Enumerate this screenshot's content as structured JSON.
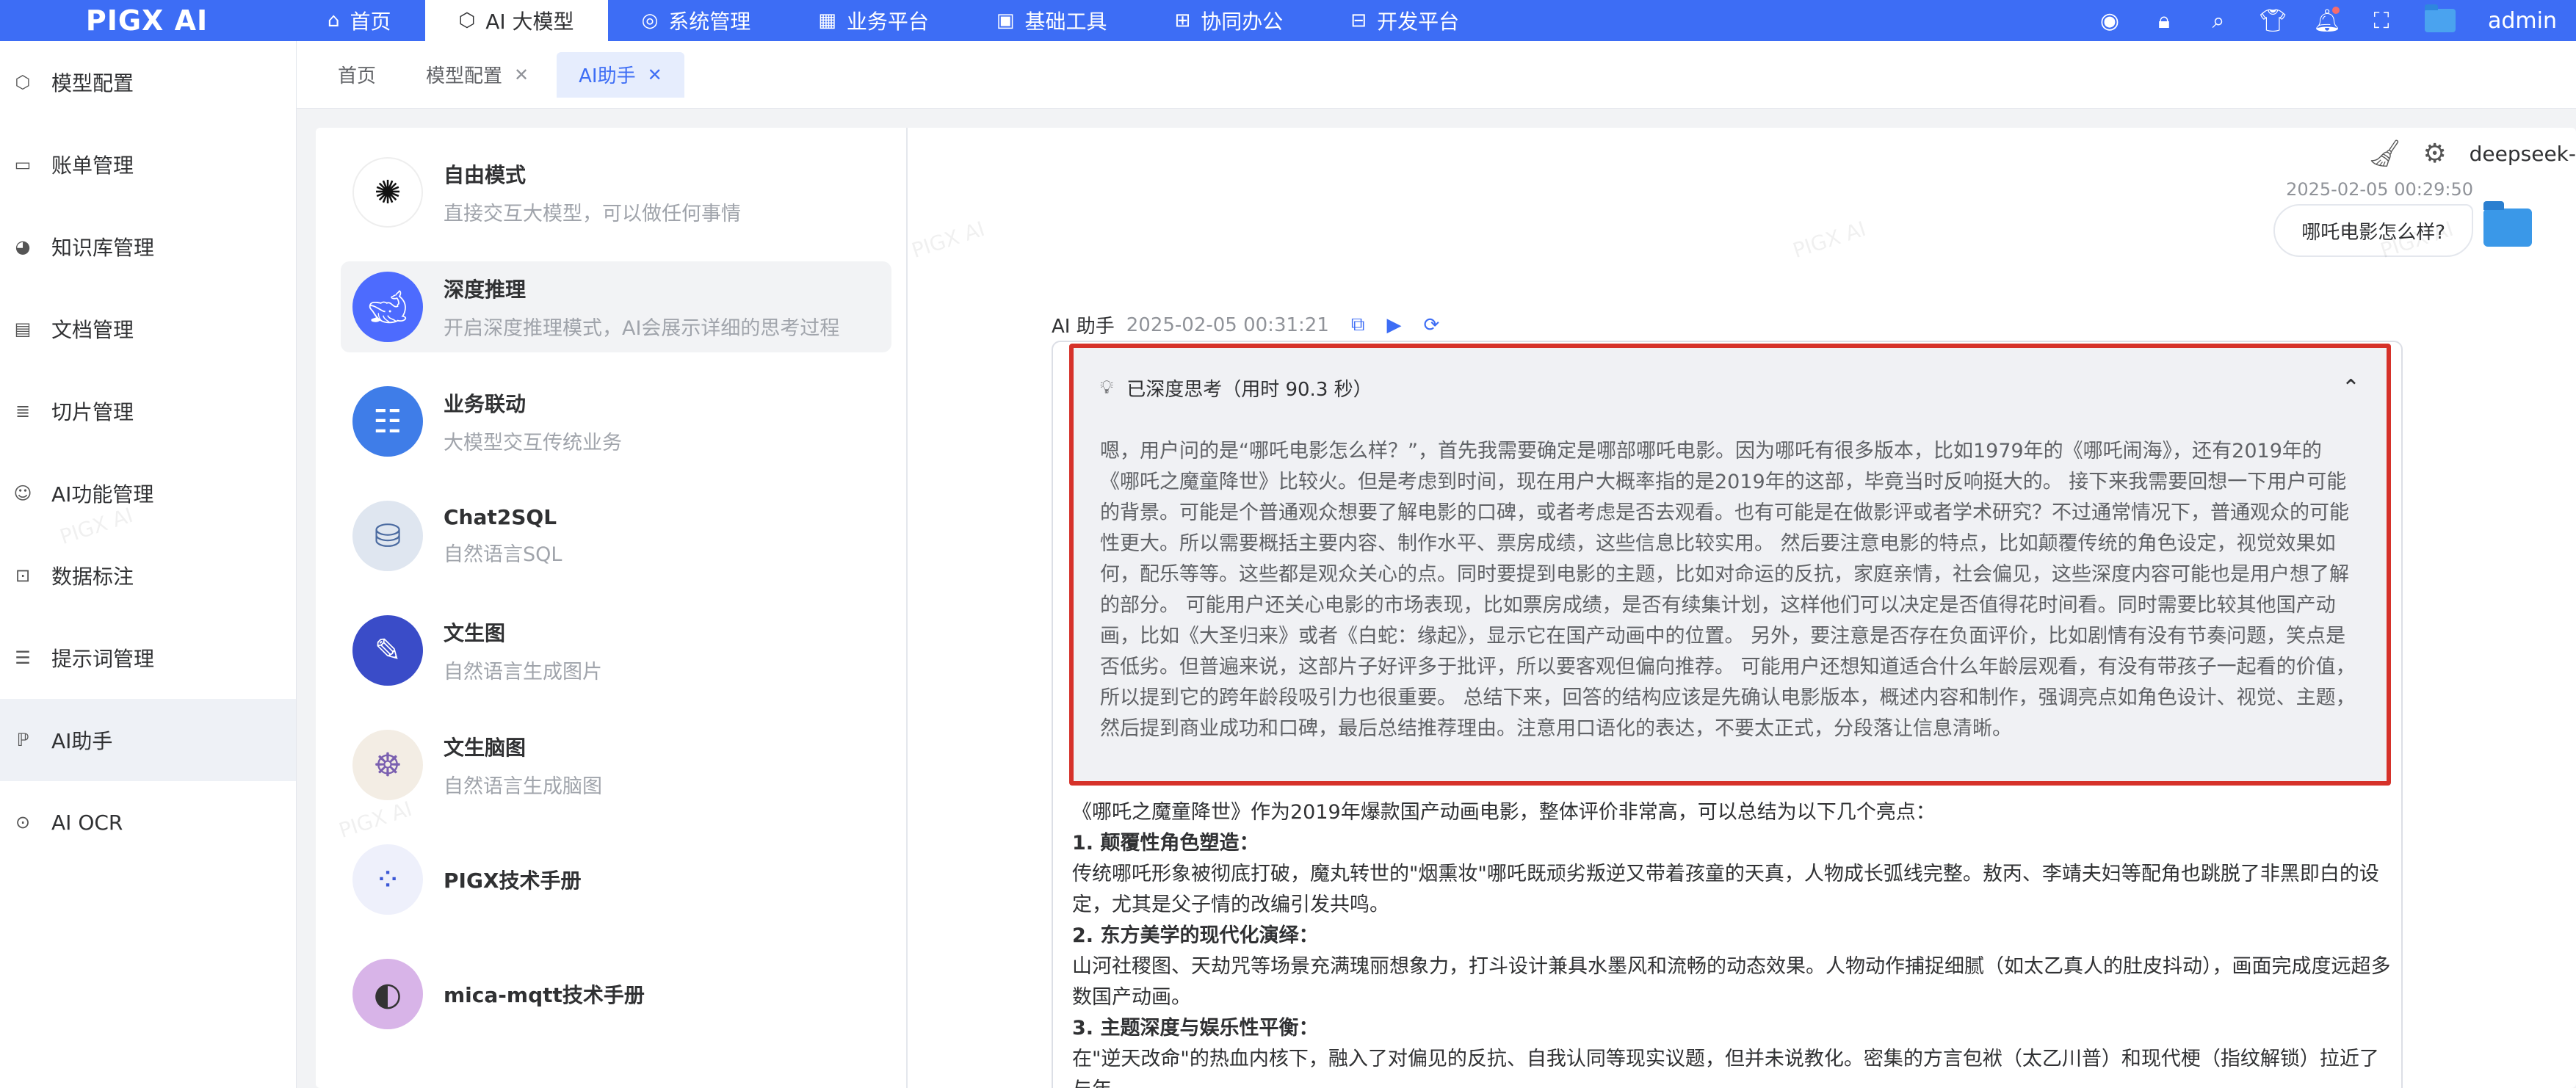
{
  "app": {
    "logo": "PIGX AI",
    "user": "admin"
  },
  "nav": [
    {
      "label": "首页",
      "icon": "home-icon"
    },
    {
      "label": "AI 大模型",
      "icon": "cube-icon",
      "active": true
    },
    {
      "label": "系统管理",
      "icon": "settings-icon"
    },
    {
      "label": "业务平台",
      "icon": "grid-icon"
    },
    {
      "label": "基础工具",
      "icon": "toolbox-icon"
    },
    {
      "label": "协同办公",
      "icon": "office-icon"
    },
    {
      "label": "开发平台",
      "icon": "dev-icon"
    }
  ],
  "sidebar": [
    {
      "label": "模型配置",
      "icon": "model-config-icon"
    },
    {
      "label": "账单管理",
      "icon": "bill-icon"
    },
    {
      "label": "知识库管理",
      "icon": "knowledge-icon"
    },
    {
      "label": "文档管理",
      "icon": "doc-icon"
    },
    {
      "label": "切片管理",
      "icon": "slice-icon"
    },
    {
      "label": "AI功能管理",
      "icon": "ai-func-icon"
    },
    {
      "label": "数据标注",
      "icon": "tag-icon"
    },
    {
      "label": "提示词管理",
      "icon": "prompt-icon"
    },
    {
      "label": "AI助手",
      "icon": "assistant-icon",
      "active": true
    },
    {
      "label": "AI OCR",
      "icon": "ocr-icon"
    }
  ],
  "tabs": [
    {
      "label": "首页",
      "closable": false
    },
    {
      "label": "模型配置",
      "closable": true
    },
    {
      "label": "AI助手",
      "closable": true,
      "active": true
    }
  ],
  "modes": [
    {
      "title": "自由模式",
      "desc": "直接交互大模型，可以做任何事情",
      "icon": "openai-icon"
    },
    {
      "title": "深度推理",
      "desc": "开启深度推理模式，AI会展示详细的思考过程",
      "icon": "whale-icon",
      "active": true
    },
    {
      "title": "业务联动",
      "desc": "大模型交互传统业务",
      "icon": "list-doc-icon"
    },
    {
      "title": "Chat2SQL",
      "desc": "自然语言SQL",
      "icon": "database-icon"
    },
    {
      "title": "文生图",
      "desc": "自然语言生成图片",
      "icon": "image-gen-icon"
    },
    {
      "title": "文生脑图",
      "desc": "自然语言生成脑图",
      "icon": "mindmap-icon"
    },
    {
      "title": "PIGX技术手册",
      "desc": "",
      "icon": "dots-icon"
    },
    {
      "title": "mica-mqtt技术手册",
      "desc": "",
      "icon": "mqtt-icon"
    }
  ],
  "chat": {
    "model": "deepseek-",
    "user_time": "2025-02-05 00:29:50",
    "user_message": "哪吒电影怎么样?",
    "ai_name": "AI 助手",
    "ai_time": "2025-02-05 00:31:21",
    "think_title": "已深度思考（用时 90.3 秒）",
    "think_text": "嗯，用户问的是“哪吒电影怎么样？”，首先我需要确定是哪部哪吒电影。因为哪吒有很多版本，比如1979年的《哪吒闹海》，还有2019年的《哪吒之魔童降世》比较火。但是考虑到时间，现在用户大概率指的是2019年的这部，毕竟当时反响挺大的。 接下来我需要回想一下用户可能的背景。可能是个普通观众想要了解电影的口碑，或者考虑是否去观看。也有可能是在做影评或者学术研究？不过通常情况下，普通观众的可能性更大。所以需要概括主要内容、制作水平、票房成绩，这些信息比较实用。 然后要注意电影的特点，比如颠覆传统的角色设定，视觉效果如何，配乐等等。这些都是观众关心的点。同时要提到电影的主题，比如对命运的反抗，家庭亲情，社会偏见，这些深度内容可能也是用户想了解的部分。 可能用户还关心电影的市场表现，比如票房成绩，是否有续集计划，这样他们可以决定是否值得花时间看。同时需要比较其他国产动画，比如《大圣归来》或者《白蛇：缘起》，显示它在国产动画中的位置。 另外，要注意是否存在负面评价，比如剧情有没有节奏问题，笑点是否低劣。但普遍来说，这部片子好评多于批评，所以要客观但偏向推荐。 可能用户还想知道适合什么年龄层观看，有没有带孩子一起看的价值，所以提到它的跨年龄段吸引力也很重要。 总结下来，回答的结构应该是先确认电影版本，概述内容和制作，强调亮点如角色设计、视觉、主题，然后提到商业成功和口碑，最后总结推荐理由。注意用口语化的表达，不要太正式，分段落让信息清晰。",
    "answer_intro": "《哪吒之魔童降世》作为2019年爆款国产动画电影，整体评价非常高，可以总结为以下几个亮点：",
    "points": [
      {
        "title": "1. 颠覆性角色塑造：",
        "text": "传统哪吒形象被彻底打破，魔丸转世的\"烟熏妆\"哪吒既顽劣叛逆又带着孩童的天真，人物成长弧线完整。敖丙、李靖夫妇等配角也跳脱了非黑即白的设定，尤其是父子情的改编引发共鸣。"
      },
      {
        "title": "2. 东方美学的现代化演绎：",
        "text": "山河社稷图、天劫咒等场景充满瑰丽想象力，打斗设计兼具水墨风和流畅的动态效果。人物动作捕捉细腻（如太乙真人的肚皮抖动），画面完成度远超多数国产动画。"
      },
      {
        "title": "3. 主题深度与娱乐性平衡：",
        "text": "在\"逆天改命\"的热血内核下，融入了对偏见的反抗、自我认同等现实议题，但并未说教化。密集的方言包袱（太乙川普）和现代梗（指纹解锁）拉近了与年"
      }
    ]
  },
  "watermark": "PIGX AI"
}
